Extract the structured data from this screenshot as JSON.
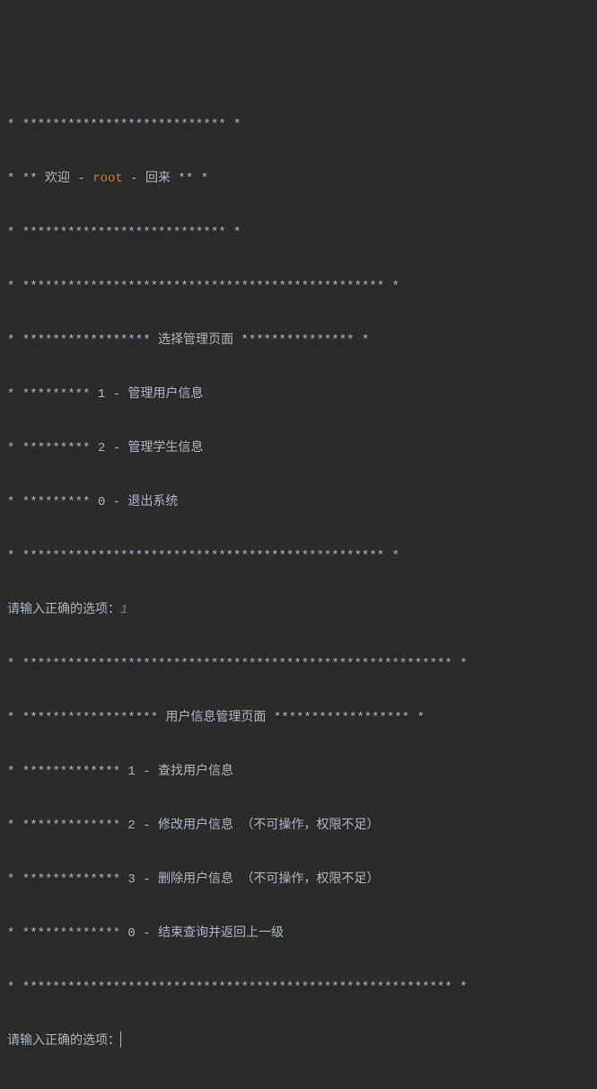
{
  "welcome": {
    "l1": "* *************************** *",
    "l2_prefix": "* ** 欢迎 - ",
    "l2_user": "root",
    "l2_suffix": " - 回来 ** *",
    "l3": "* *************************** *"
  },
  "menu1": {
    "border_top": "* ************************************************ *",
    "title": "* ***************** 选择管理页面 *************** *",
    "opt1": "* ********* 1 - 管理用户信息",
    "opt2": "* ********* 2 - 管理学生信息",
    "opt0": "* ********* 0 - 退出系统",
    "border_bottom": "* ************************************************ *",
    "prompt": "请输入正确的选项：",
    "input": "1"
  },
  "menu2": {
    "border_top": "* ********************************************************* *",
    "title": "* ****************** 用户信息管理页面 ****************** *",
    "opt1": "* ************* 1 - 查找用户信息",
    "opt2": "* ************* 2 - 修改用户信息 （不可操作，权限不足）",
    "opt3": "* ************* 3 - 删除用户信息 （不可操作，权限不足）",
    "opt0": "* ************* 0 - 结束查询并返回上一级",
    "border_bottom": "* ********************************************************* *",
    "prompt": "请输入正确的选项："
  }
}
